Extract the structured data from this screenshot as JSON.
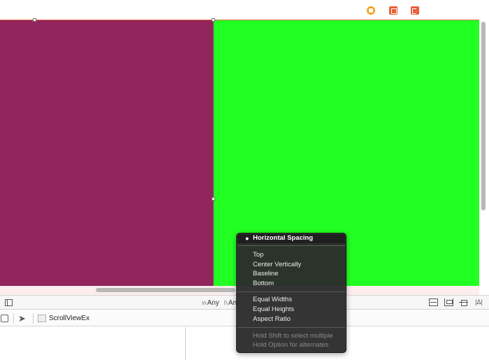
{
  "canvas": {
    "left_view_color": "#93245c",
    "right_view_color": "#22ff22",
    "scene_dock_icons": [
      "view-controller-icon",
      "first-responder-icon",
      "exit-icon"
    ]
  },
  "size_class": {
    "w_prefix": "w",
    "w_value": "Any",
    "h_prefix": "h",
    "h_value": "Any"
  },
  "layout_buttons": [
    "stack-icon",
    "align-icon",
    "pin-icon",
    "resolve-issues-icon"
  ],
  "jump_bar": {
    "file_name": "ScrollViewEx"
  },
  "menu": {
    "bullet": "●",
    "groups": [
      [
        "Horizontal Spacing"
      ],
      [
        "Top",
        "Center Vertically",
        "Baseline",
        "Bottom"
      ],
      [
        "Equal Widths",
        "Equal Heights",
        "Aspect Ratio"
      ],
      [
        "Hold Shift to select multiple",
        "Hold Option for alternates"
      ]
    ]
  }
}
